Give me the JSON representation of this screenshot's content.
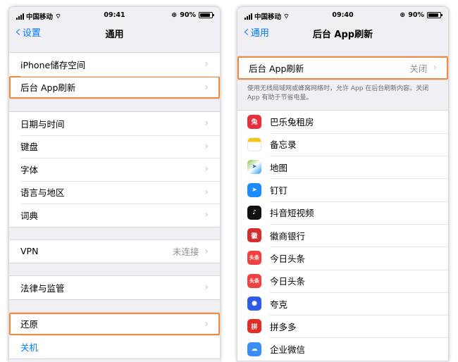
{
  "left": {
    "status": {
      "carrier": "中国移动",
      "time": "09:41",
      "battery": "90%",
      "battery_level": 0.9
    },
    "nav": {
      "back_label": "设置",
      "title": "通用"
    },
    "group1": [
      {
        "label": "iPhone储存空间",
        "highlighted": false
      },
      {
        "label": "后台 App刷新",
        "highlighted": true
      }
    ],
    "group2": [
      {
        "label": "日期与时间"
      },
      {
        "label": "键盘"
      },
      {
        "label": "字体"
      },
      {
        "label": "语言与地区"
      },
      {
        "label": "词典"
      }
    ],
    "group3": [
      {
        "label": "VPN",
        "value": "未连接"
      }
    ],
    "group4": [
      {
        "label": "法律与监管"
      }
    ],
    "group5": [
      {
        "label": "还原",
        "highlighted": true
      },
      {
        "label": "关机"
      }
    ]
  },
  "right": {
    "status": {
      "carrier": "中国移动",
      "time": "09:40",
      "battery": "90%",
      "battery_level": 0.9
    },
    "nav": {
      "back_label": "通用",
      "title": "后台 App刷新"
    },
    "main_row": {
      "label": "后台 App刷新",
      "value": "关闭"
    },
    "footnote": "使用无线局域网或蜂窝网络时，允许 App 在后台刷新内容。关闭 App 有助于节省电量。",
    "apps": [
      {
        "name": "巴乐兔租房",
        "icon": "rabbit-icon",
        "color": "#e8303d",
        "glyph": "兔"
      },
      {
        "name": "备忘录",
        "icon": "notes-icon",
        "color": "#f5c518",
        "glyph": ""
      },
      {
        "name": "地图",
        "icon": "maps-icon",
        "color": "#4caf50",
        "glyph": "➤"
      },
      {
        "name": "钉钉",
        "icon": "dingtalk-icon",
        "color": "#1a8cff",
        "glyph": "➤"
      },
      {
        "name": "抖音短视频",
        "icon": "douyin-icon",
        "color": "#111111",
        "glyph": "♪"
      },
      {
        "name": "徽商银行",
        "icon": "bank-icon",
        "color": "#d32f2f",
        "glyph": "徽"
      },
      {
        "name": "今日头条",
        "icon": "toutiao-icon",
        "color": "#f04142",
        "glyph": "头条"
      },
      {
        "name": "今日头条",
        "icon": "toutiao-icon",
        "color": "#f04142",
        "glyph": "头条"
      },
      {
        "name": "夸克",
        "icon": "quark-icon",
        "color": "#2f5bea",
        "glyph": "●"
      },
      {
        "name": "拼多多",
        "icon": "pinduoduo-icon",
        "color": "#e02e24",
        "glyph": "拼"
      },
      {
        "name": "企业微信",
        "icon": "wecom-icon",
        "color": "#3a8ef6",
        "glyph": "☁"
      }
    ]
  }
}
